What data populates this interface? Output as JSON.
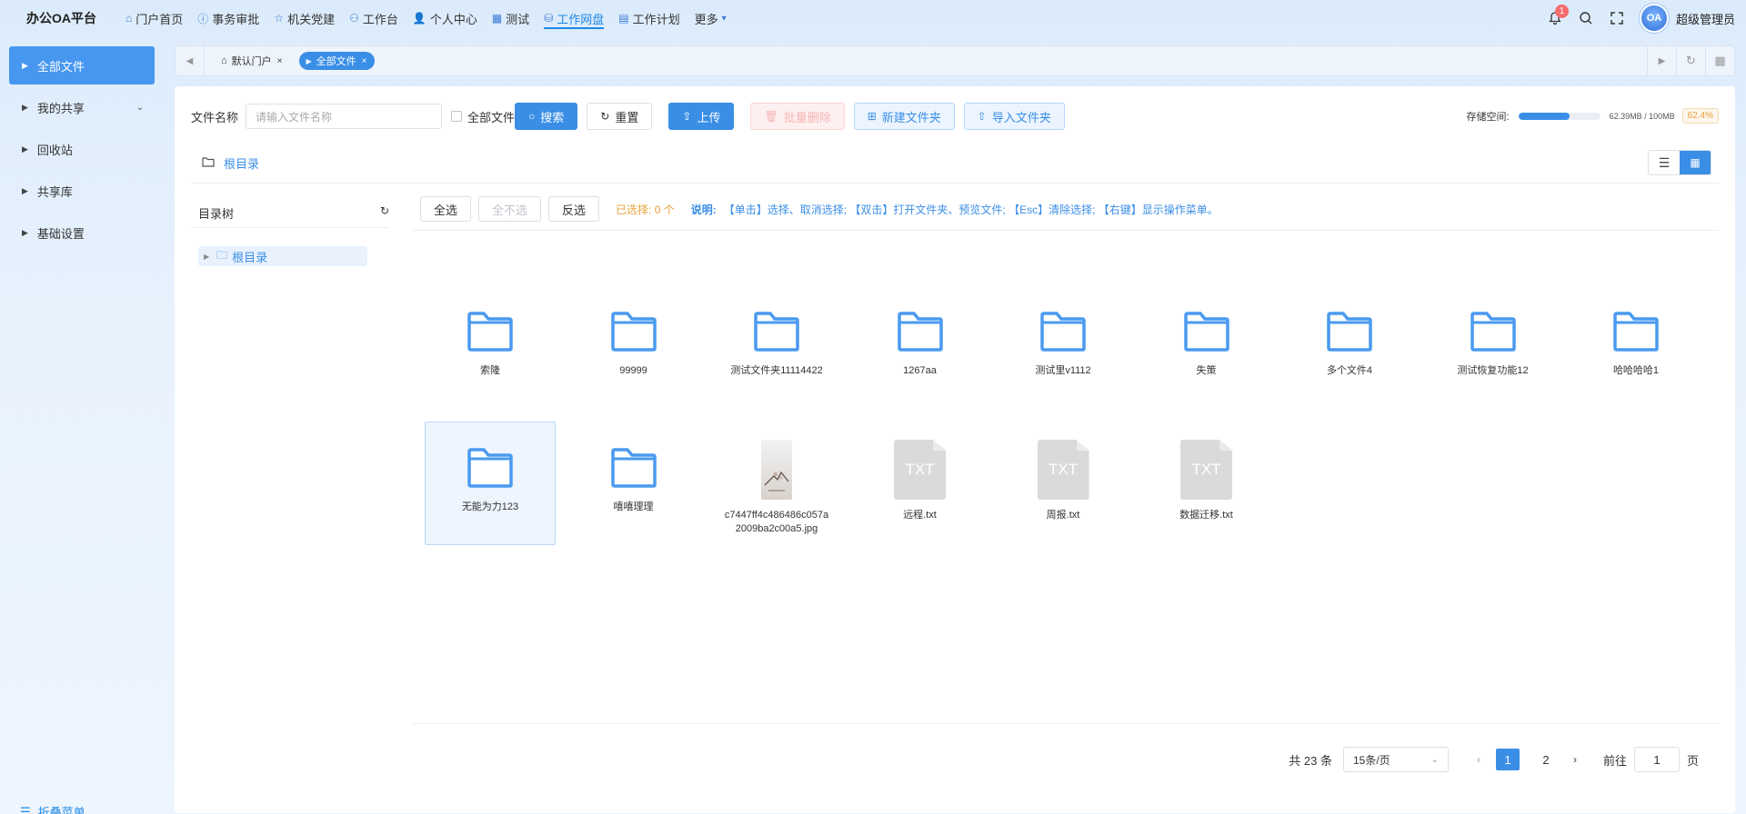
{
  "brand": "办公OA平台",
  "nav": [
    {
      "label": "门户首页",
      "icon": "home-icon"
    },
    {
      "label": "事务审批",
      "icon": "info-icon"
    },
    {
      "label": "机关党建",
      "icon": "star-icon"
    },
    {
      "label": "工作台",
      "icon": "org-icon"
    },
    {
      "label": "个人中心",
      "icon": "user-icon"
    },
    {
      "label": "测试",
      "icon": "grid-icon"
    },
    {
      "label": "工作网盘",
      "icon": "disk-icon",
      "active": true
    },
    {
      "label": "工作计划",
      "icon": "calendar-icon"
    },
    {
      "label": "更多",
      "icon": "chevron-down-icon"
    }
  ],
  "top_right": {
    "notification_count": "1",
    "avatar_text": "OA",
    "username": "超级管理员"
  },
  "sidebar": {
    "items": [
      {
        "label": "全部文件",
        "active": true
      },
      {
        "label": "我的共享",
        "has_sub": true
      },
      {
        "label": "回收站"
      },
      {
        "label": "共享库"
      },
      {
        "label": "基础设置"
      }
    ],
    "collapse_label": "折叠菜单"
  },
  "tabs": [
    {
      "label": "默认门户",
      "active": false
    },
    {
      "label": "全部文件",
      "active": true
    }
  ],
  "toolbar": {
    "file_name_label": "文件名称",
    "search_placeholder": "请输入文件名称",
    "all_files_label": "全部文件",
    "search_label": "搜索",
    "reset_label": "重置",
    "upload_label": "上传",
    "batch_delete_label": "批量删除",
    "new_folder_label": "新建文件夹",
    "import_folder_label": "导入文件夹"
  },
  "storage": {
    "label": "存储空间:",
    "usage": "62.39MB / 100MB",
    "percent": "62.4%",
    "fraction": 0.624
  },
  "breadcrumb": {
    "root": "根目录"
  },
  "tree": {
    "title": "目录树",
    "root": "根目录"
  },
  "selection": {
    "select_all": "全选",
    "select_none": "全不选",
    "invert": "反选",
    "selected_info": "已选择: 0 个",
    "note_label": "说明:",
    "note_text": "【单击】选择、取消选择; 【双击】打开文件夹、预览文件; 【Esc】清除选择; 【右键】显示操作菜单。"
  },
  "files": [
    {
      "name": "索隆",
      "type": "folder"
    },
    {
      "name": "99999",
      "type": "folder"
    },
    {
      "name": "测试文件夹11114422",
      "type": "folder"
    },
    {
      "name": "1267aa",
      "type": "folder"
    },
    {
      "name": "测试里v1112",
      "type": "folder"
    },
    {
      "name": "失策",
      "type": "folder"
    },
    {
      "name": "多个文件4",
      "type": "folder"
    },
    {
      "name": "测试恢复功能12",
      "type": "folder"
    },
    {
      "name": "哈哈哈哈1",
      "type": "folder"
    },
    {
      "name": "无能为力123",
      "type": "folder",
      "selected": true
    },
    {
      "name": "嘻嘻理理",
      "type": "folder"
    },
    {
      "name": "c7447ff4c486486c057a2009ba2c00a5.jpg",
      "type": "image"
    },
    {
      "name": "远程.txt",
      "type": "txt",
      "badge": "TXT"
    },
    {
      "name": "周报.txt",
      "type": "txt",
      "badge": "TXT"
    },
    {
      "name": "数据迁移.txt",
      "type": "txt",
      "badge": "TXT"
    }
  ],
  "pagination": {
    "total": "共 23 条",
    "page_size": "15条/页",
    "pages": [
      "1",
      "2"
    ],
    "current": "1",
    "goto_label": "前往",
    "goto_value": "1",
    "page_unit": "页"
  },
  "colors": {
    "accent": "#3a8ee6",
    "folder": "#4a9af0",
    "warning": "#e6a23c"
  }
}
